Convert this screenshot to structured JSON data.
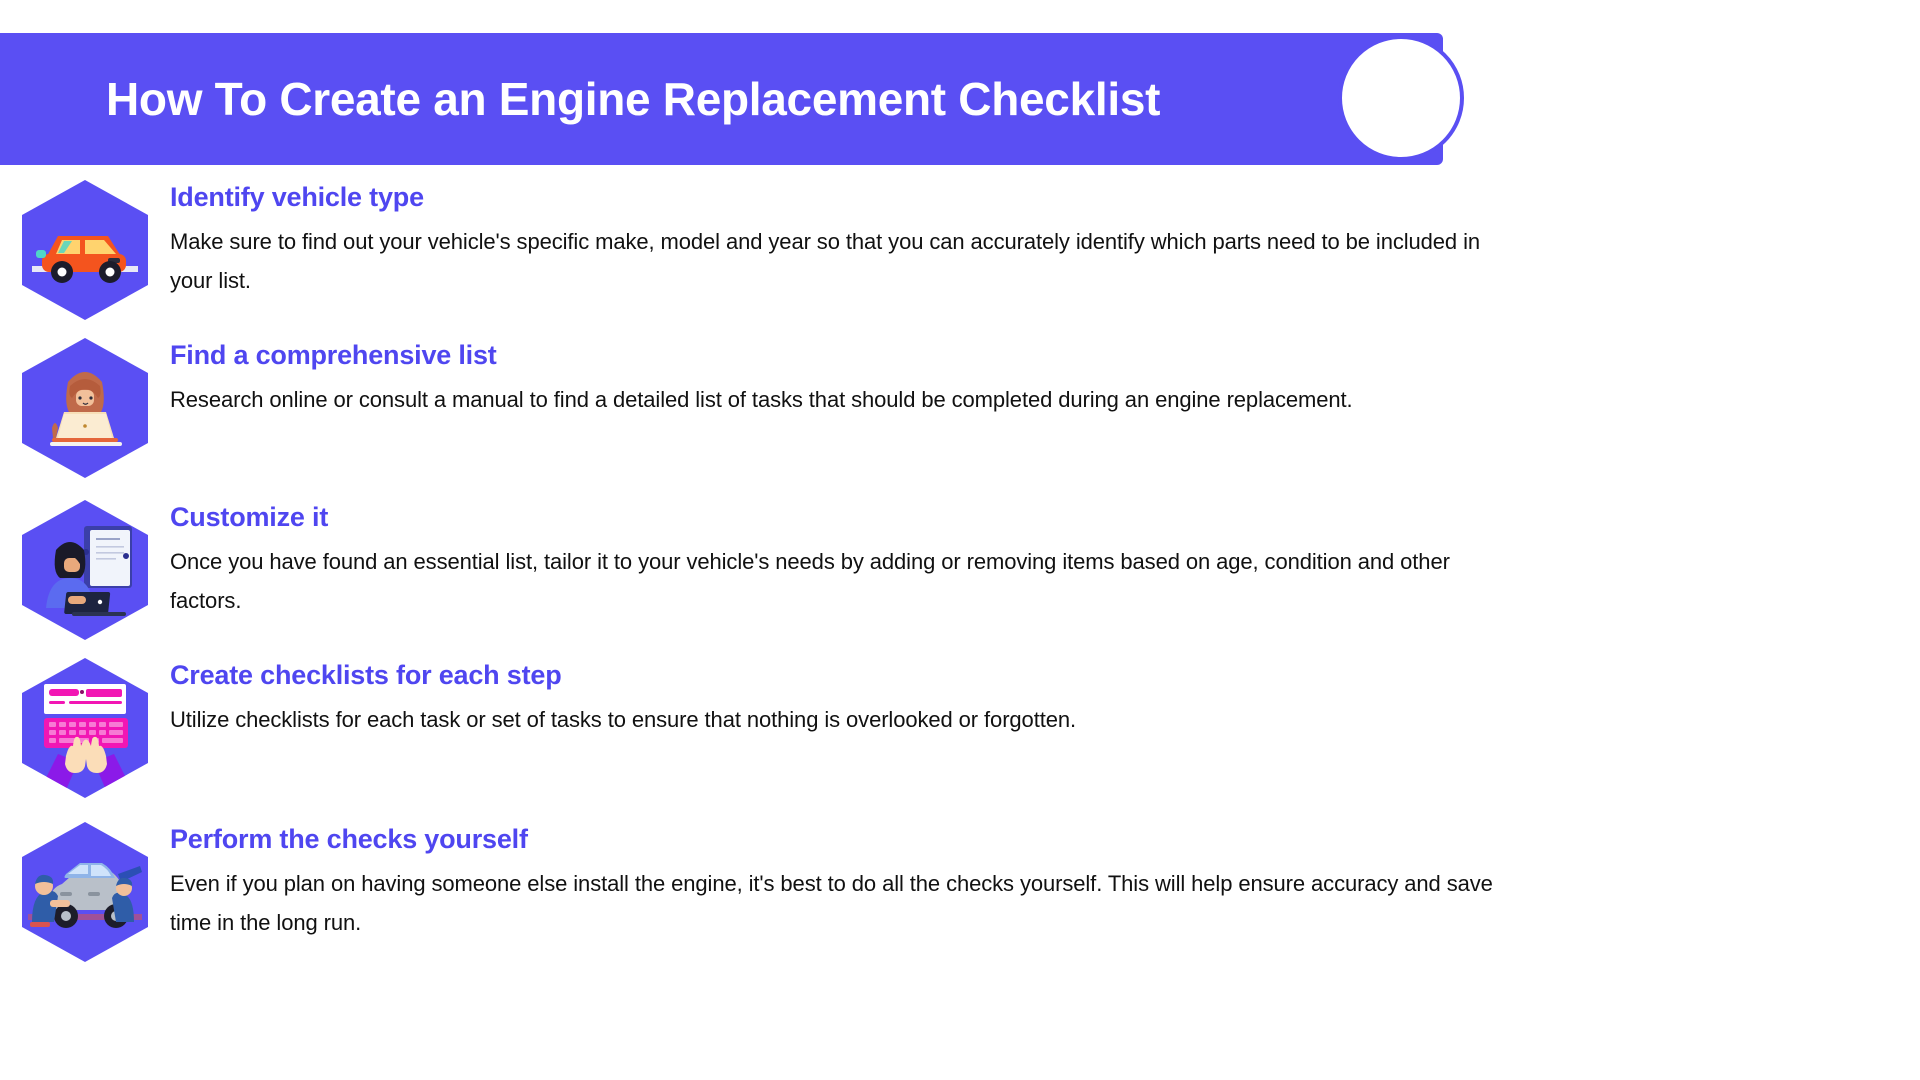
{
  "header": {
    "title": "How To Create an Engine Replacement Checklist",
    "band_color": "#5a4ff3",
    "title_color": "#ffffff",
    "circle_name": "decorative-circle"
  },
  "theme": {
    "accent": "#5a4ff3",
    "heading_color": "#4f46f0",
    "body_color": "#111111",
    "background": "#ffffff"
  },
  "steps": [
    {
      "icon": "hexagon-orange-car-icon",
      "title": "Identify vehicle type",
      "description": "Make sure to find out your vehicle's specific make, model and year so that you can accurately identify which parts need to be included in your list."
    },
    {
      "icon": "hexagon-woman-at-laptop-icon",
      "title": "Find a comprehensive list",
      "description": "Research online or consult a manual to find a detailed list of tasks that should be completed during an engine replacement."
    },
    {
      "icon": "hexagon-woman-with-document-board-icon",
      "title": "Customize it",
      "description": "Once you have found an essential list, tailor it to your vehicle's needs by adding or removing items based on age, condition and other factors."
    },
    {
      "icon": "hexagon-hands-typing-keyboard-icon",
      "title": "Create checklists for each step",
      "description": "Utilize checklists for each task or set of tasks to ensure that nothing is overlooked or forgotten."
    },
    {
      "icon": "hexagon-mechanics-repairing-car-icon",
      "title": "Perform the checks yourself",
      "description": "Even if you plan on having someone else install the engine, it's best to do all the checks yourself. This will help ensure accuracy and save time in the long run."
    }
  ]
}
